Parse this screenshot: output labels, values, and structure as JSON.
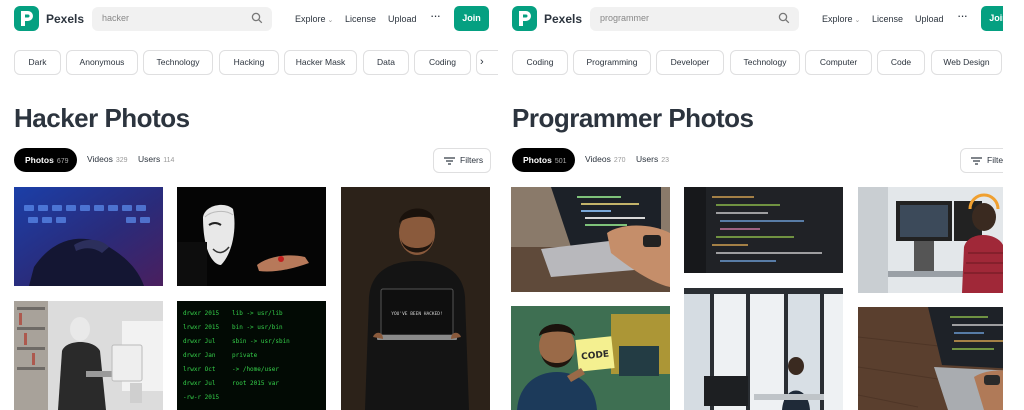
{
  "panels": [
    {
      "brand": "Pexels",
      "search_value": "hacker",
      "nav": {
        "explore": "Explore",
        "license": "License",
        "upload": "Upload",
        "more": "···",
        "join": "Join"
      },
      "chips": [
        "Dark",
        "Anonymous",
        "Technology",
        "Hacking",
        "Hacker Mask",
        "Data",
        "Coding"
      ],
      "title": "Hacker Photos",
      "tabs": {
        "photos": "Photos",
        "photos_count": "679",
        "videos": "Videos",
        "videos_count": "329",
        "users": "Users",
        "users_count": "114"
      },
      "filters": "Filters",
      "laptop_screen_text": "YOU'VE BEEN HACKED!",
      "terminal_lines": [
        "lib -> usr/lib",
        "bin -> usr/bin",
        "sbin -> usr/sbin",
        "private",
        "-> /home/user",
        "root  2015  var"
      ]
    },
    {
      "brand": "Pexels",
      "search_value": "programmer",
      "nav": {
        "explore": "Explore",
        "license": "License",
        "upload": "Upload",
        "more": "···",
        "join": "Join"
      },
      "chips": [
        "Coding",
        "Programming",
        "Developer",
        "Technology",
        "Computer",
        "Code",
        "Web Design"
      ],
      "title": "Programmer Photos",
      "tabs": {
        "photos": "Photos",
        "photos_count": "501",
        "videos": "Videos",
        "videos_count": "270",
        "users": "Users",
        "users_count": "23"
      },
      "filters": "Filters",
      "sticky_note_text": "CODE"
    }
  ],
  "colors": {
    "accent": "#05a081",
    "text": "#2c343e",
    "chip_border": "#dfdfe0"
  }
}
